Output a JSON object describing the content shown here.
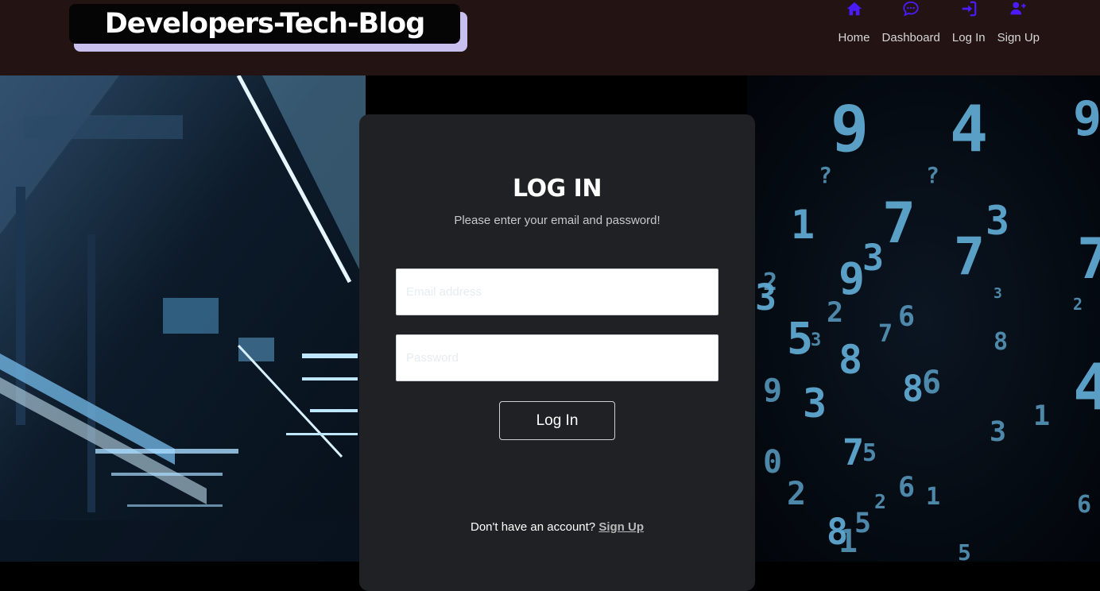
{
  "header": {
    "logo_text": "Developers-Tech-Blog",
    "nav": [
      {
        "label": "Home",
        "icon": "home-icon"
      },
      {
        "label": "Dashboard",
        "icon": "chat-bubble-icon"
      },
      {
        "label": "Log In",
        "icon": "sign-in-icon"
      },
      {
        "label": "Sign Up",
        "icon": "user-plus-icon"
      }
    ]
  },
  "login": {
    "title": "LOG IN",
    "subtitle": "Please enter your email and password!",
    "email_placeholder": "Email address",
    "email_value": "",
    "password_placeholder": "Password",
    "password_value": "",
    "submit_label": "Log In",
    "signup_prompt": "Don't have an account?",
    "signup_link": "Sign Up"
  },
  "colors": {
    "header_bg": "#231313",
    "nav_icon": "#4a1bff",
    "card_bg": "#1f2124",
    "logo_shadow": "#c7c0ef",
    "digit_color": "#5fa7cf"
  },
  "background": {
    "digits": [
      "9",
      "4",
      "9",
      "7",
      "?",
      "?",
      "1",
      "7",
      "3",
      "3",
      "7",
      "9",
      "2",
      "3",
      "2",
      "2",
      "6",
      "7",
      "5",
      "8",
      "3",
      "9",
      "3",
      "8",
      "6",
      "8",
      "1",
      "3",
      "7",
      "5",
      "0",
      "2",
      "6",
      "2",
      "1",
      "8",
      "5",
      "1",
      "5",
      "4",
      "6",
      "3"
    ]
  }
}
